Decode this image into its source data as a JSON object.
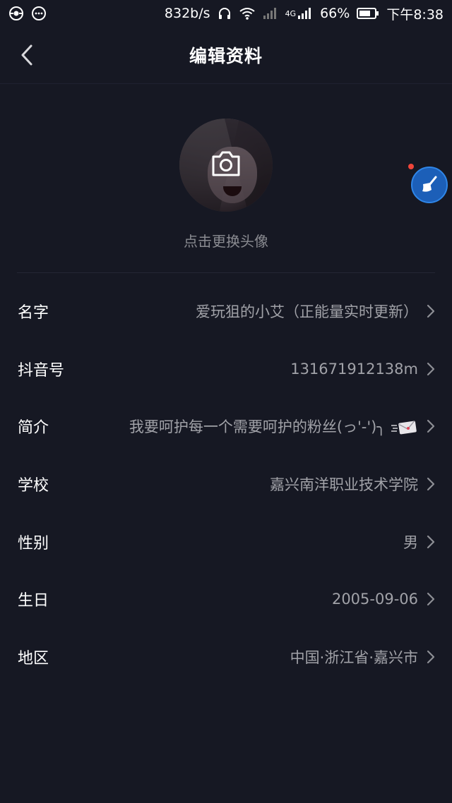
{
  "status_bar": {
    "speed": "832b/s",
    "network": "4G",
    "battery": "66%",
    "time": "下午8:38",
    "icons": [
      "app-icon",
      "chat-icon",
      "headphones-icon",
      "wifi-icon",
      "signal-icon",
      "battery-icon"
    ]
  },
  "header": {
    "title": "编辑资料",
    "back_icon": "chevron-left-icon"
  },
  "avatar": {
    "caption": "点击更换头像",
    "icon": "camera-icon"
  },
  "floating_button": {
    "icon": "broom-icon",
    "color": "#1c5fb8",
    "badge_color": "#f0453a"
  },
  "fields": [
    {
      "label": "名字",
      "value": "爱玩狙的小艾（正能量实时更新）"
    },
    {
      "label": "抖音号",
      "value": "131671912138m"
    },
    {
      "label": "简介",
      "value": "我要呵护每一个需要呵护的粉丝(っ'-')╮"
    },
    {
      "label": "学校",
      "value": "嘉兴南洋职业技术学院"
    },
    {
      "label": "性别",
      "value": "男"
    },
    {
      "label": "生日",
      "value": "2005-09-06"
    },
    {
      "label": "地区",
      "value": "中国·浙江省·嘉兴市"
    }
  ],
  "colors": {
    "background": "#161823",
    "label": "#ffffff",
    "value": "#a1a2a8",
    "caption": "#8a8b91"
  }
}
